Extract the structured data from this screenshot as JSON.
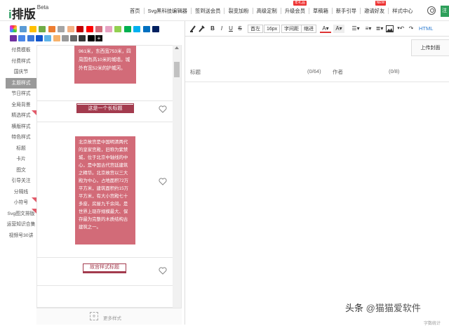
{
  "brand": {
    "logo_i": "i",
    "logo_text": "排版",
    "logo_sup": "Beta"
  },
  "nav": {
    "items": [
      {
        "label": "首页"
      },
      {
        "label": "Svg黑科技编辑器"
      },
      {
        "label": "签到送会员"
      },
      {
        "label": "裂变加粉"
      },
      {
        "label": "高级定制"
      },
      {
        "label": "升级会员",
        "badge": "年礼品"
      },
      {
        "label": "草稿箱"
      },
      {
        "label": "新手引导"
      },
      {
        "label": "邀请好友",
        "badge": "NEW"
      },
      {
        "label": "样式中心"
      }
    ],
    "green_btn": "注"
  },
  "palette": {
    "row1": [
      "#5b9bd5",
      "#ffc000",
      "#70ad47",
      "#ed7d31",
      "#a5a5a5",
      "#f4b183",
      "#c00000",
      "#ff0000",
      "#d26b78",
      "#e7a3c3",
      "#92d050",
      "#00b050",
      "#00b0f0",
      "#0070c0",
      "#002060"
    ],
    "row2": [
      "#7030a0",
      "#4a86e8",
      "#3c78d8",
      "#1155cc",
      "#5fb3e8",
      "#f6b26b",
      "#999999",
      "#666666",
      "#333333",
      "#000000"
    ],
    "plus": "+"
  },
  "categories": [
    {
      "label": "付费模板"
    },
    {
      "label": "付费样式"
    },
    {
      "label": "国庆节"
    },
    {
      "label": "主题样式",
      "active": true
    },
    {
      "label": "节日样式"
    },
    {
      "label": "全局背景"
    },
    {
      "label": "精选样式",
      "corner": true
    },
    {
      "label": "横版样式"
    },
    {
      "label": "特色样式"
    },
    {
      "label": "标题"
    },
    {
      "label": "卡片"
    },
    {
      "label": "图文"
    },
    {
      "label": "引导关注"
    },
    {
      "label": "分隔线"
    },
    {
      "label": "小符号",
      "corner": true
    },
    {
      "label": "Svg图文排版",
      "corner": true
    },
    {
      "label": "运营知识合集"
    },
    {
      "label": "视频号30讲"
    }
  ],
  "cards": {
    "c1_text": "961米，东西宽753米，四周围有高10米的城墙，城外有宽52米的护城河。",
    "c2_title": "这是一个长标题",
    "c3_text": "北京故宫是中国明清两代的皇家宫殿，旧称为紫禁城，位于北京中轴线的中心，是中国古代宫廷建筑之精华。北京故宫以三大殿为中心，占地面积72万平方米，建筑面积约15万平方米，有大小宫殿七十多座，房屋九千余间。是世界上现存规模最大、保存最为完整的木质结构古建筑之一。",
    "c4_title": "故宫样式标题"
  },
  "more": {
    "icon": "+",
    "label": "更多样式"
  },
  "toolbar": {
    "b": "B",
    "i": "I",
    "u": "U",
    "s": "S",
    "indent": "首左",
    "size": "16px",
    "spacing": "字间距",
    "lineh": "缩进",
    "html": "HTML"
  },
  "fields": {
    "title_label": "标题",
    "title_count": "(0/64)",
    "author_label": "作者",
    "author_count": "(0/8)",
    "upload": "上传封面"
  },
  "footer": {
    "word_count": "字数统计"
  },
  "watermark": {
    "a": "头条 ",
    "b": "@猫猫爱软件"
  }
}
